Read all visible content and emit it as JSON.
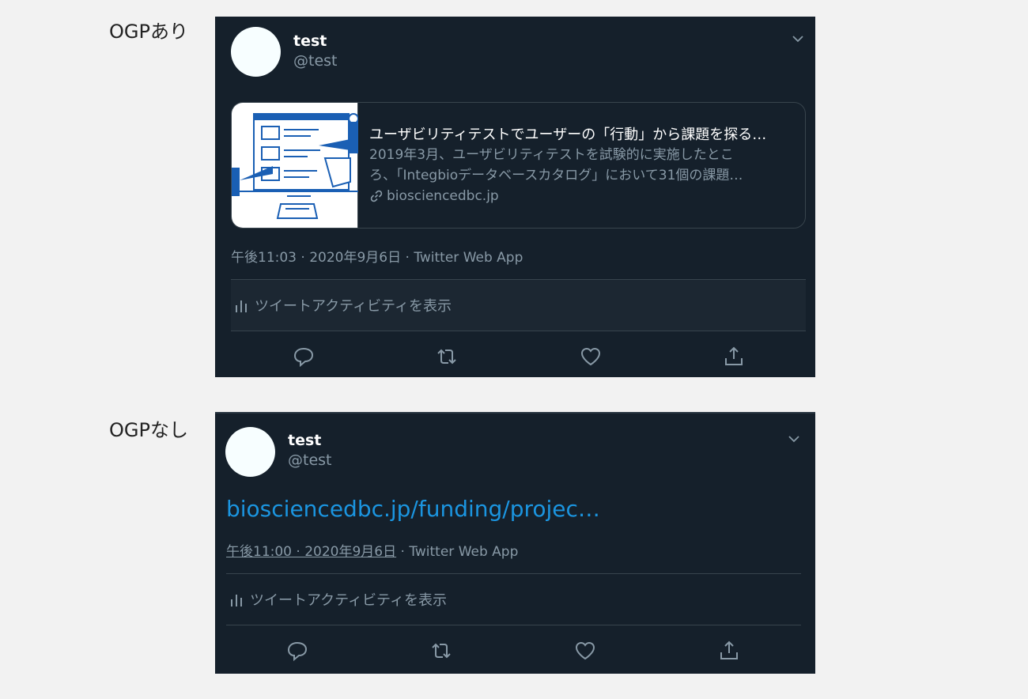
{
  "sections": [
    {
      "label": "OGPあり",
      "tweet": {
        "name": "test",
        "handle": "@test",
        "card": {
          "title": "ユーザビリティテストでユーザーの「行動」から課題を探る…",
          "desc_line1": "2019年3月、ユーザビリティテストを試験的に実施したとこ",
          "desc_line2": "ろ、「Integbioデータベースカタログ」において31個の課題…",
          "domain": "biosciencedbc.jp"
        },
        "timestamp": "午後11:03 · 2020年9月6日",
        "source": " · Twitter Web App",
        "activity_label": "ツイートアクティビティを表示"
      }
    },
    {
      "label": "OGPなし",
      "tweet": {
        "name": "test",
        "handle": "@test",
        "link": "biosciencedbc.jp/funding/projec…",
        "timestamp": "午後11:00 · 2020年9月6日",
        "source": " · Twitter Web App",
        "activity_label": "ツイートアクティビティを表示"
      }
    }
  ],
  "colors": {
    "page_bg": "#f2f2f2",
    "tweet_bg": "#15202b",
    "secondary_text": "#8899a6",
    "link": "#1b95e0",
    "border": "#38444d"
  },
  "icons": [
    "chevron-down-icon",
    "link-icon",
    "bar-chart-icon",
    "reply-icon",
    "retweet-icon",
    "like-icon",
    "share-icon"
  ]
}
